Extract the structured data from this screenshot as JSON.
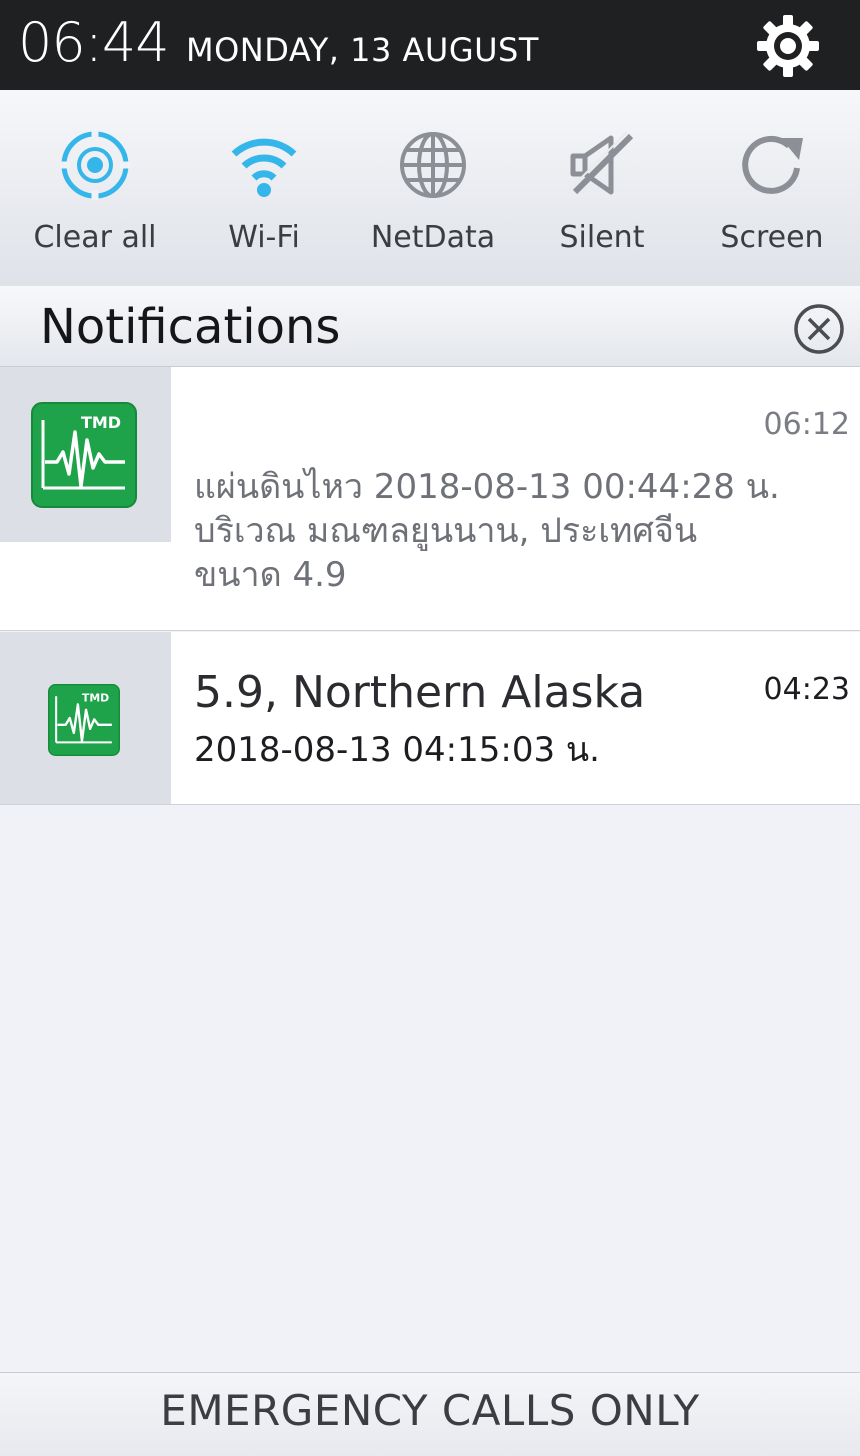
{
  "status_bar": {
    "time": "06:44",
    "date": "MONDAY, 13 AUGUST",
    "settings_icon": "gear-icon"
  },
  "quick_settings": [
    {
      "label": "Clear all",
      "icon": "target-icon",
      "color": "#35b6ea"
    },
    {
      "label": "Wi-Fi",
      "icon": "wifi-icon",
      "color": "#35b6ea"
    },
    {
      "label": "NetData",
      "icon": "globe-icon",
      "color": "#8c8f95"
    },
    {
      "label": "Silent",
      "icon": "speaker-muted-icon",
      "color": "#8c8f95"
    },
    {
      "label": "Screen",
      "icon": "rotate-icon",
      "color": "#8c8f95"
    }
  ],
  "notifications_panel": {
    "title": "Notifications",
    "clear_icon": "close-circle-icon"
  },
  "notifications": [
    {
      "time": "06:12",
      "message": "แผ่นดินไหว 2018-08-13 00:44:28 น.\nบริเวณ มณฑลยูนนาน, ประเทศจีน\nขนาด 4.9",
      "app_icon_text": "TMD"
    },
    {
      "title": "5.9, Northern Alaska",
      "time": "04:23",
      "message": "2018-08-13 04:15:03 น.",
      "app_icon_text": "TMD"
    }
  ],
  "bottom": {
    "text": "EMERGENCY CALLS ONLY"
  },
  "colors": {
    "accent": "#35b6ea",
    "app_icon_green": "#1fa34a"
  }
}
